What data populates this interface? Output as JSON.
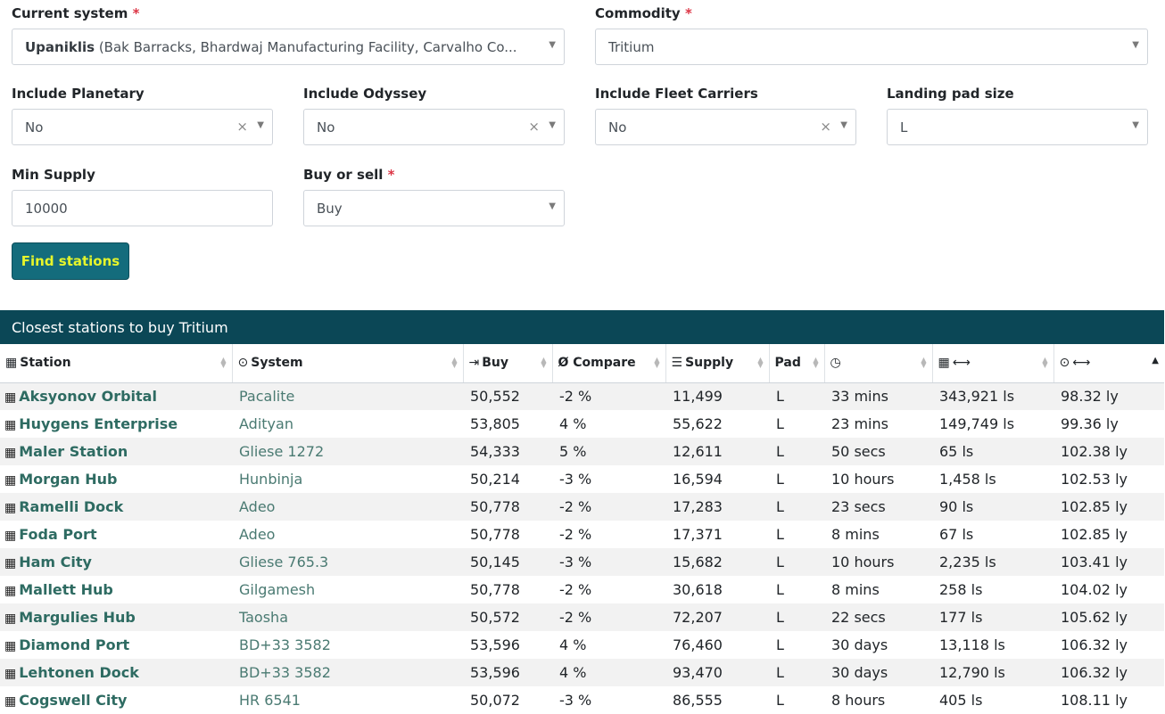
{
  "form": {
    "current_system": {
      "label": "Current system",
      "required_mark": "*",
      "value_name": "Upaniklis",
      "value_detail": "(Bak Barracks, Bhardwaj Manufacturing Facility, Carvalho Co..."
    },
    "commodity": {
      "label": "Commodity",
      "required_mark": "*",
      "value": "Tritium"
    },
    "include_planetary": {
      "label": "Include Planetary",
      "value": "No",
      "clear": "×"
    },
    "include_odyssey": {
      "label": "Include Odyssey",
      "value": "No",
      "clear": "×"
    },
    "include_fleet_carriers": {
      "label": "Include Fleet Carriers",
      "value": "No",
      "clear": "×"
    },
    "landing_pad_size": {
      "label": "Landing pad size",
      "value": "L"
    },
    "min_supply": {
      "label": "Min Supply",
      "value": "10000"
    },
    "buy_or_sell": {
      "label": "Buy or sell",
      "required_mark": "*",
      "value": "Buy"
    },
    "find_button": "Find stations",
    "arrow": "▼"
  },
  "results": {
    "title": "Closest stations to buy Tritium",
    "columns": {
      "station": "Station",
      "system": "System",
      "buy": "Buy",
      "compare": "Ø Compare",
      "supply": "Supply",
      "pad": "Pad",
      "updated": "",
      "station_distance": "",
      "system_distance": ""
    },
    "rows": [
      {
        "station": "Aksyonov Orbital",
        "system": "Pacalite",
        "buy": "50,552",
        "compare": "-2 %",
        "supply": "11,499",
        "pad": "L",
        "updated": "33 mins",
        "station_distance": "343,921 ls",
        "system_distance": "98.32 ly"
      },
      {
        "station": "Huygens Enterprise",
        "system": "Adityan",
        "buy": "53,805",
        "compare": "4 %",
        "supply": "55,622",
        "pad": "L",
        "updated": "23 mins",
        "station_distance": "149,749 ls",
        "system_distance": "99.36 ly"
      },
      {
        "station": "Maler Station",
        "system": "Gliese 1272",
        "buy": "54,333",
        "compare": "5 %",
        "supply": "12,611",
        "pad": "L",
        "updated": "50 secs",
        "station_distance": "65 ls",
        "system_distance": "102.38 ly"
      },
      {
        "station": "Morgan Hub",
        "system": "Hunbinja",
        "buy": "50,214",
        "compare": "-3 %",
        "supply": "16,594",
        "pad": "L",
        "updated": "10 hours",
        "station_distance": "1,458 ls",
        "system_distance": "102.53 ly"
      },
      {
        "station": "Ramelli Dock",
        "system": "Adeo",
        "buy": "50,778",
        "compare": "-2 %",
        "supply": "17,283",
        "pad": "L",
        "updated": "23 secs",
        "station_distance": "90 ls",
        "system_distance": "102.85 ly"
      },
      {
        "station": "Foda Port",
        "system": "Adeo",
        "buy": "50,778",
        "compare": "-2 %",
        "supply": "17,371",
        "pad": "L",
        "updated": "8 mins",
        "station_distance": "67 ls",
        "system_distance": "102.85 ly"
      },
      {
        "station": "Ham City",
        "system": "Gliese 765.3",
        "buy": "50,145",
        "compare": "-3 %",
        "supply": "15,682",
        "pad": "L",
        "updated": "10 hours",
        "station_distance": "2,235 ls",
        "system_distance": "103.41 ly"
      },
      {
        "station": "Mallett Hub",
        "system": "Gilgamesh",
        "buy": "50,778",
        "compare": "-2 %",
        "supply": "30,618",
        "pad": "L",
        "updated": "8 mins",
        "station_distance": "258 ls",
        "system_distance": "104.02 ly"
      },
      {
        "station": "Margulies Hub",
        "system": "Taosha",
        "buy": "50,572",
        "compare": "-2 %",
        "supply": "72,207",
        "pad": "L",
        "updated": "22 secs",
        "station_distance": "177 ls",
        "system_distance": "105.62 ly"
      },
      {
        "station": "Diamond Port",
        "system": "BD+33 3582",
        "buy": "53,596",
        "compare": "4 %",
        "supply": "76,460",
        "pad": "L",
        "updated": "30 days",
        "station_distance": "13,118 ls",
        "system_distance": "106.32 ly"
      },
      {
        "station": "Lehtonen Dock",
        "system": "BD+33 3582",
        "buy": "53,596",
        "compare": "4 %",
        "supply": "93,470",
        "pad": "L",
        "updated": "30 days",
        "station_distance": "12,790 ls",
        "system_distance": "106.32 ly"
      },
      {
        "station": "Cogswell City",
        "system": "HR 6541",
        "buy": "50,072",
        "compare": "-3 %",
        "supply": "86,555",
        "pad": "L",
        "updated": "8 hours",
        "station_distance": "405 ls",
        "system_distance": "108.11 ly"
      }
    ]
  },
  "icons": {
    "building": "building-icon",
    "target": "target-icon",
    "sign_in": "sign-in-icon",
    "list": "list-icon",
    "clock": "clock-icon",
    "distance": "arrows-horizontal-icon"
  },
  "colors": {
    "header_bg": "#0b4756",
    "button_bg": "#146c7c",
    "button_text": "#e6f52b",
    "station_link": "#2e6b62",
    "required": "#dc3545"
  }
}
